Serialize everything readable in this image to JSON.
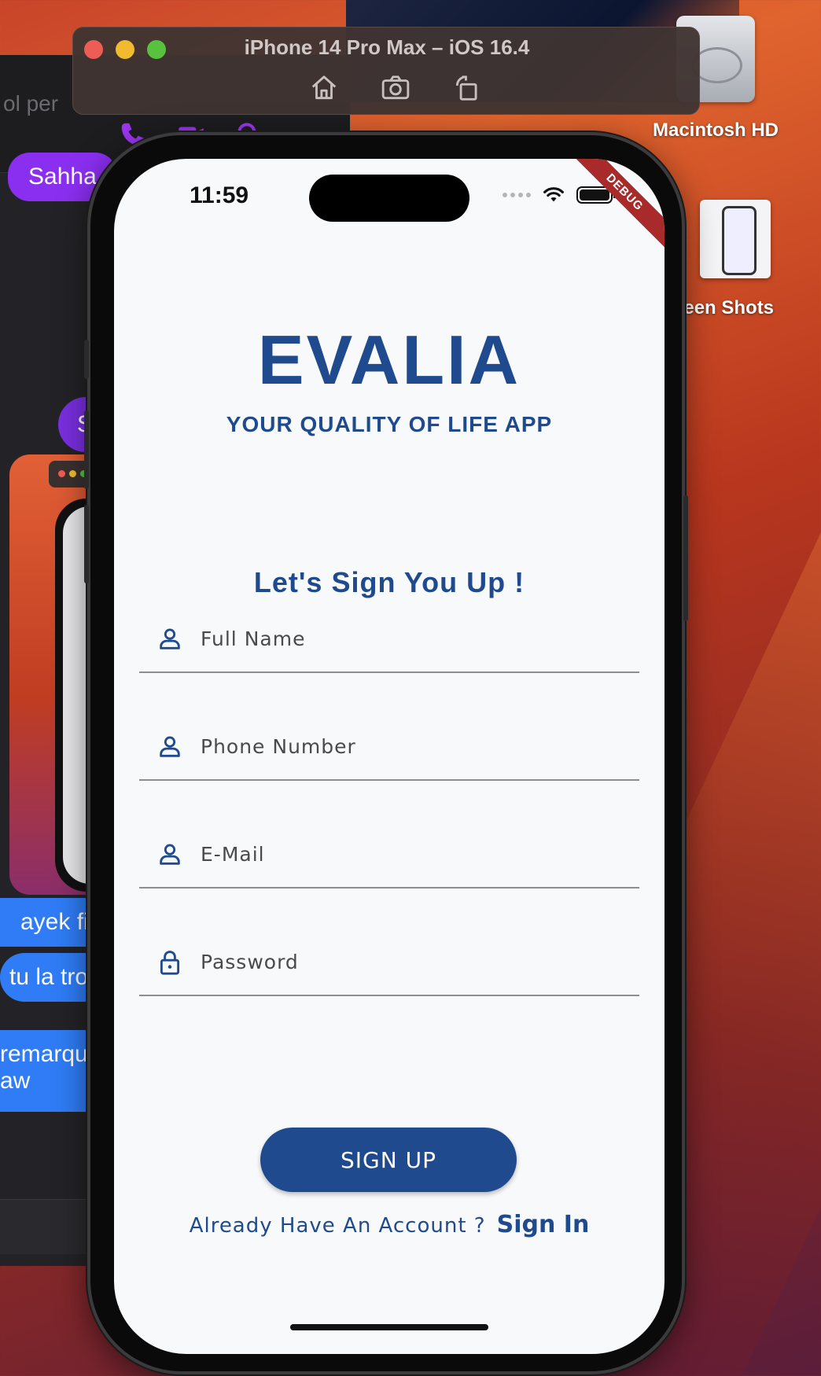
{
  "desktop": {
    "icons": [
      {
        "label": "Macintosh HD"
      },
      {
        "label": "reen Shots"
      }
    ]
  },
  "background_window": {
    "header_text": "ol per",
    "messages": [
      {
        "text": "Sahha",
        "style": "purple"
      },
      {
        "text": "ayek fi pa",
        "style": "blue"
      },
      {
        "text": "tu la tro",
        "style": "blue"
      },
      {
        "text": "remarqu\naw",
        "style": "blue"
      }
    ],
    "avatar_initial": "S"
  },
  "simulator": {
    "title": "iPhone 14 Pro Max – iOS 16.4",
    "tools": [
      "home-icon",
      "screenshot-icon",
      "rotate-icon"
    ]
  },
  "status_bar": {
    "time": "11:59",
    "debug_label": "DEBUG"
  },
  "app": {
    "brand": "EVALIA",
    "tagline": "YOUR QUALITY OF LIFE APP",
    "heading": "Let's Sign You Up !",
    "fields": [
      {
        "placeholder": "Full Name",
        "value": "",
        "icon": "person-icon"
      },
      {
        "placeholder": "Phone Number",
        "value": "",
        "icon": "person-icon"
      },
      {
        "placeholder": "E-Mail",
        "value": "",
        "icon": "person-icon"
      },
      {
        "placeholder": "Password",
        "value": "",
        "icon": "lock-icon"
      }
    ],
    "signup_button": "SIGN UP",
    "signin_prompt": "Already Have An Account ?",
    "signin_link": "Sign In",
    "brand_color": "#1f4b8e"
  }
}
